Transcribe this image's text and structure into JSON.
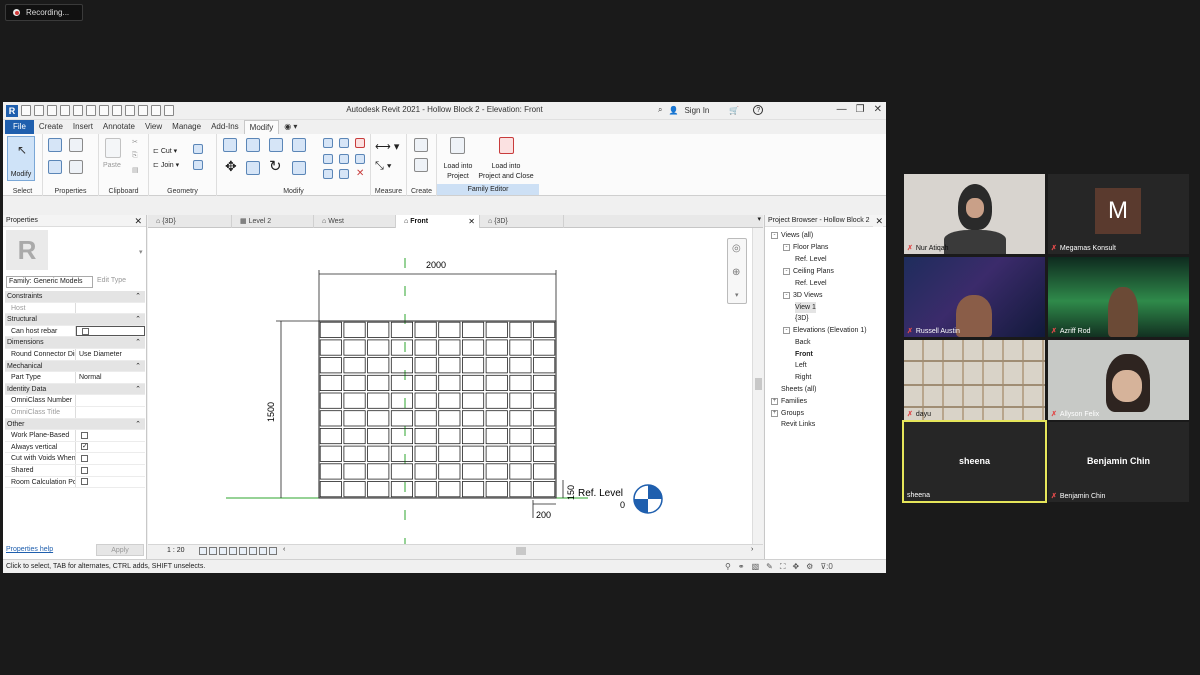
{
  "recording": {
    "label": "Recording..."
  },
  "revit": {
    "window_title": "Autodesk Revit 2021 - Hollow Block 2 - Elevation: Front",
    "sign_in": "Sign In",
    "help": "?",
    "menu_tabs": [
      "File",
      "Create",
      "Insert",
      "Annotate",
      "View",
      "Manage",
      "Add-Ins",
      "Modify"
    ],
    "active_menu_tab": "Modify",
    "ribbon": {
      "modify_label": "Modify",
      "select_label": "Select",
      "properties_label": "Properties",
      "paste_label": "Paste",
      "clipboard_label": "Clipboard",
      "cut_label": "Cut",
      "join_label": "Join",
      "geometry_label": "Geometry",
      "modify_group_label": "Modify",
      "measure_label": "Measure",
      "create_label": "Create",
      "load_into_project": "Load into Project",
      "load_into_project_l1": "Load into",
      "load_into_project_l2": "Project",
      "load_close_l1": "Load into",
      "load_close_l2": "Project and Close",
      "family_editor_label": "Family Editor"
    },
    "properties": {
      "title": "Properties",
      "logo_letter": "R",
      "family": "Family: Generic Models",
      "edit_type": "Edit Type",
      "rows": [
        {
          "cat": "Constraints"
        },
        {
          "k": "Host",
          "v": "",
          "disabled": true
        },
        {
          "cat": "Structural"
        },
        {
          "k": "Can host rebar",
          "v": "",
          "checkbox": false,
          "field": true
        },
        {
          "cat": "Dimensions"
        },
        {
          "k": "Round Connector Dimension",
          "v": "Use Diameter"
        },
        {
          "cat": "Mechanical"
        },
        {
          "k": "Part Type",
          "v": "Normal"
        },
        {
          "cat": "Identity Data"
        },
        {
          "k": "OmniClass Number",
          "v": ""
        },
        {
          "k": "OmniClass Title",
          "v": "",
          "disabled": true
        },
        {
          "cat": "Other"
        },
        {
          "k": "Work Plane-Based",
          "checkbox": false
        },
        {
          "k": "Always vertical",
          "checkbox": true
        },
        {
          "k": "Cut with Voids When Loaded",
          "checkbox": false
        },
        {
          "k": "Shared",
          "checkbox": false
        },
        {
          "k": "Room Calculation Point",
          "checkbox": false
        }
      ],
      "help_link": "Properties help",
      "apply": "Apply"
    },
    "view_tabs": [
      {
        "label": "{3D}",
        "active": false
      },
      {
        "label": "Level 2",
        "active": false
      },
      {
        "label": "West",
        "active": false
      },
      {
        "label": "Front",
        "active": true
      },
      {
        "label": "{3D}",
        "active": false
      }
    ],
    "drawing": {
      "dim_width": "2000",
      "dim_height": "1500",
      "dim_150": "150",
      "dim_200": "200",
      "ref_level": "Ref. Level",
      "ref_level_value": "0",
      "grid_cols": 10,
      "grid_rows": 10
    },
    "view_scale": "1 : 20",
    "browser": {
      "title": "Project Browser - Hollow Block 2",
      "items": [
        {
          "label": "Views (all)",
          "level": 0,
          "toggle": "-"
        },
        {
          "label": "Floor Plans",
          "level": 1,
          "toggle": "-"
        },
        {
          "label": "Ref. Level",
          "level": 2
        },
        {
          "label": "Ceiling Plans",
          "level": 1,
          "toggle": "-"
        },
        {
          "label": "Ref. Level",
          "level": 2
        },
        {
          "label": "3D Views",
          "level": 1,
          "toggle": "-"
        },
        {
          "label": "View 1",
          "level": 2,
          "selected": true
        },
        {
          "label": "{3D}",
          "level": 2
        },
        {
          "label": "Elevations (Elevation 1)",
          "level": 1,
          "toggle": "-"
        },
        {
          "label": "Back",
          "level": 2
        },
        {
          "label": "Front",
          "level": 2,
          "bold": true
        },
        {
          "label": "Left",
          "level": 2
        },
        {
          "label": "Right",
          "level": 2
        },
        {
          "label": "Sheets (all)",
          "level": 0
        },
        {
          "label": "Families",
          "level": 0,
          "toggle": "+"
        },
        {
          "label": "Groups",
          "level": 0,
          "toggle": "+"
        },
        {
          "label": "Revit Links",
          "level": 0
        }
      ]
    },
    "status": "Click to select, TAB for alternates, CTRL adds, SHIFT unselects.",
    "status_filter": ":0"
  },
  "participants": [
    {
      "name": "Nur Atiqah",
      "muted": true
    },
    {
      "name": "Megamas Konsult",
      "muted": true,
      "avatar": "M"
    },
    {
      "name": "Russell Austin",
      "muted": true
    },
    {
      "name": "Azriff Rod",
      "muted": true
    },
    {
      "name": "dayu",
      "muted": true
    },
    {
      "name": "Allyson Felix",
      "muted": true
    },
    {
      "name": "sheena",
      "muted": false,
      "big": "sheena",
      "active": true
    },
    {
      "name": "Benjamin Chin",
      "muted": true,
      "big": "Benjamin Chin"
    }
  ],
  "colors": {
    "revit_blue": "#1f5fae",
    "level_green": "#2ea52e",
    "active_speaker": "#e5e55a",
    "mute_red": "#e04a4a"
  }
}
